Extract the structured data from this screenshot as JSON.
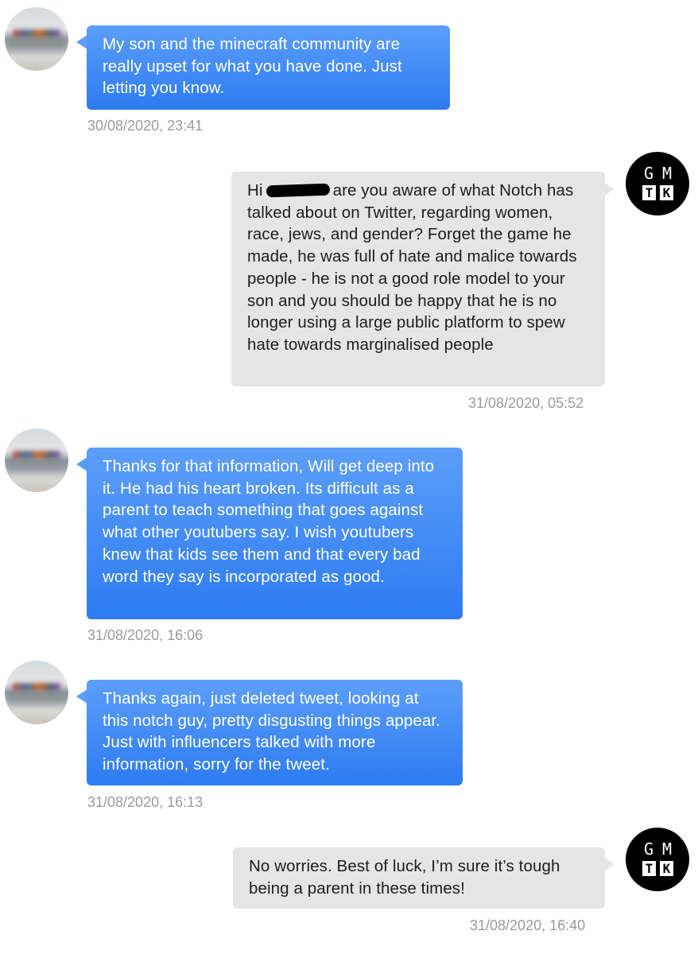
{
  "messages": [
    {
      "from": "contact",
      "text": "My son and the minecraft community are really upset for what  you have done. Just letting you know.",
      "timestamp": "30/08/2020, 23:41"
    },
    {
      "from": "me",
      "text_before": "Hi",
      "text_after": "are you aware of what Notch has talked about on Twitter, regarding women, race, jews, and gender? Forget the game he made, he was full of hate and malice towards people - he is not a good role model to your son and you should be happy that he is no longer using a large public platform to spew hate towards marginalised people",
      "timestamp": "31/08/2020, 05:52"
    },
    {
      "from": "contact",
      "text": "Thanks for that information, Will get deep into it. He had his heart broken. Its difficult as a parent to teach something that goes against what other youtubers say. I wish youtubers knew that kids see them and that every bad word they say is incorporated as good.",
      "timestamp": "31/08/2020, 16:06"
    },
    {
      "from": "contact",
      "text": "Thanks again, just deleted tweet, looking at this notch guy, pretty disgusting things appear. Just with influencers talked with more information, sorry for the tweet.",
      "timestamp": "31/08/2020, 16:13"
    },
    {
      "from": "me",
      "text": "No worries. Best of luck, I’m sure it’s tough being a parent in these times!",
      "timestamp": "31/08/2020, 16:40"
    }
  ],
  "logo": {
    "top_left": "G",
    "top_right": "M",
    "bottom_left": "T",
    "bottom_right": "K"
  },
  "colors": {
    "incoming_top": "#5c9ef9",
    "incoming_bottom": "#2d7bf2",
    "outgoing": "#e5e5e5",
    "timestamp": "#9a9a9a"
  }
}
